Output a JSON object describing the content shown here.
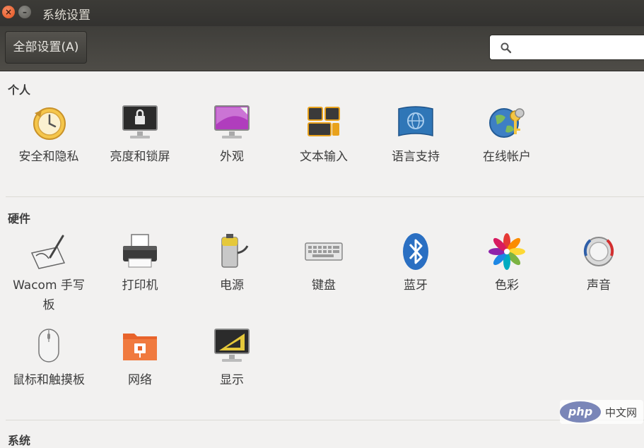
{
  "window": {
    "title": "系统设置"
  },
  "toolbar": {
    "all_settings_label": "全部设置(A)",
    "search_placeholder": ""
  },
  "sections": {
    "personal": {
      "title": "个人",
      "items": [
        "安全和隐私",
        "亮度和锁屏",
        "外观",
        "文本输入",
        "语言支持",
        "在线帐户"
      ]
    },
    "hardware": {
      "title": "硬件",
      "items": [
        "Wacom 手写板",
        "打印机",
        "电源",
        "键盘",
        "蓝牙",
        "色彩",
        "声音",
        "鼠标和触摸板",
        "网络",
        "显示"
      ]
    },
    "system": {
      "title": "系统"
    }
  },
  "watermark": {
    "logo_text": "php",
    "text": "中文网"
  },
  "colors": {
    "titlebar": "#3c3b37",
    "close": "#e5521c",
    "background": "#f2f1f0"
  }
}
